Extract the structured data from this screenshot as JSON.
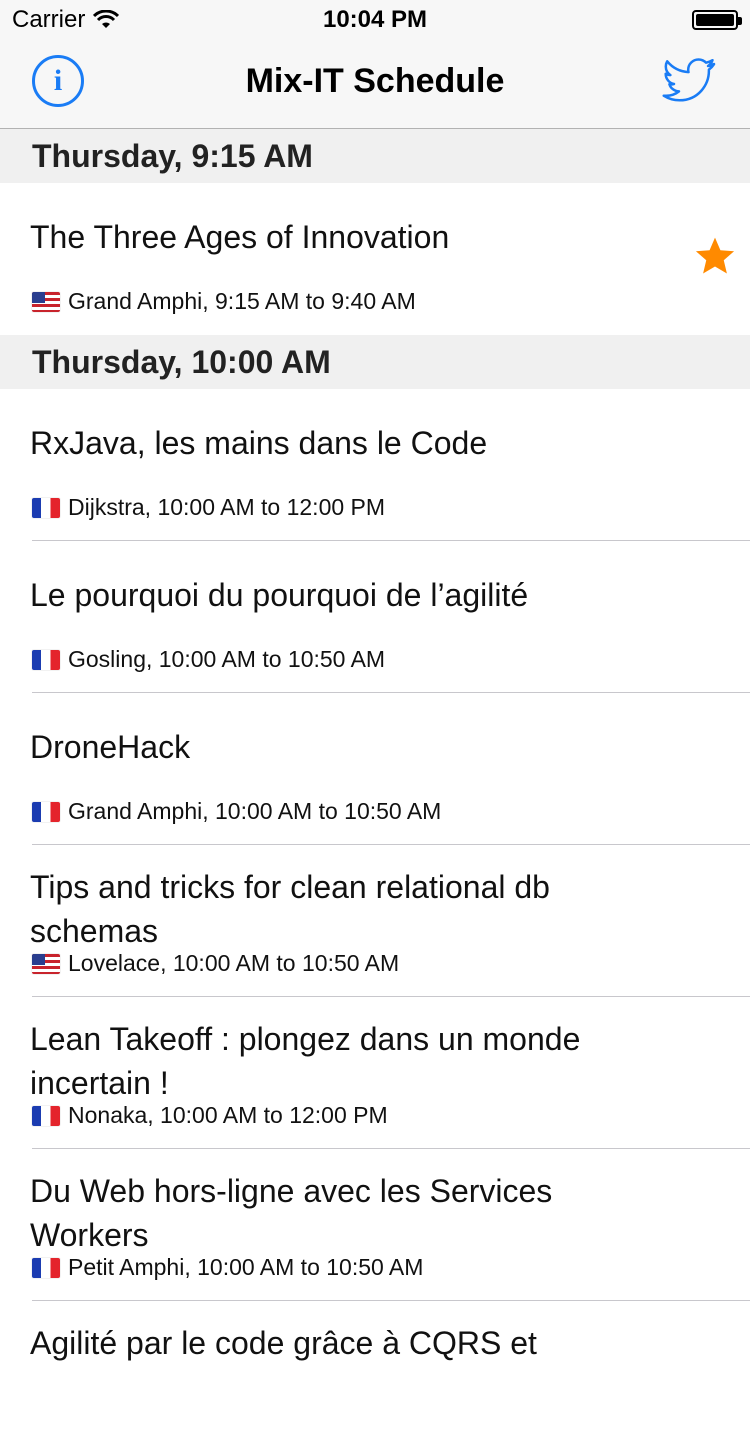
{
  "status_bar": {
    "carrier": "Carrier",
    "time": "10:04 PM"
  },
  "nav": {
    "title": "Mix-IT Schedule",
    "info_glyph": "i",
    "info_icon": "info-icon",
    "right_icon": "twitter-icon"
  },
  "colors": {
    "accent": "#1a7cf5",
    "star": "#ff8a00",
    "header_bg": "#f0f0f0",
    "nav_bg": "#f7f7f7"
  },
  "sections": [
    {
      "header": "Thursday, 9:15 AM",
      "items": [
        {
          "title": "The Three Ages of Innovation",
          "meta": "Grand Amphi, 9:15 AM to 9:40 AM",
          "flag": "us",
          "favorite": true
        }
      ]
    },
    {
      "header": "Thursday, 10:00 AM",
      "items": [
        {
          "title": "RxJava, les mains dans le Code",
          "meta": "Dijkstra, 10:00 AM to 12:00 PM",
          "flag": "fr",
          "favorite": false
        },
        {
          "title": "Le pourquoi du pourquoi de l’agilité",
          "meta": "Gosling, 10:00 AM to 10:50 AM",
          "flag": "fr",
          "favorite": false
        },
        {
          "title": "DroneHack",
          "meta": "Grand Amphi, 10:00 AM to 10:50 AM",
          "flag": "fr",
          "favorite": false
        },
        {
          "title": "Tips and tricks for clean relational db schemas",
          "meta": "Lovelace, 10:00 AM to 10:50 AM",
          "flag": "us",
          "favorite": false
        },
        {
          "title": "Lean Takeoff : plongez dans un monde incertain !",
          "meta": "Nonaka, 10:00 AM to 12:00 PM",
          "flag": "fr",
          "favorite": false
        },
        {
          "title": "Du Web hors-ligne avec les Services Workers",
          "meta": "Petit Amphi, 10:00 AM to 10:50 AM",
          "flag": "fr",
          "favorite": false
        },
        {
          "title": "Agilité par le code grâce à CQRS et",
          "meta": "",
          "flag": "fr",
          "favorite": false
        }
      ]
    }
  ]
}
